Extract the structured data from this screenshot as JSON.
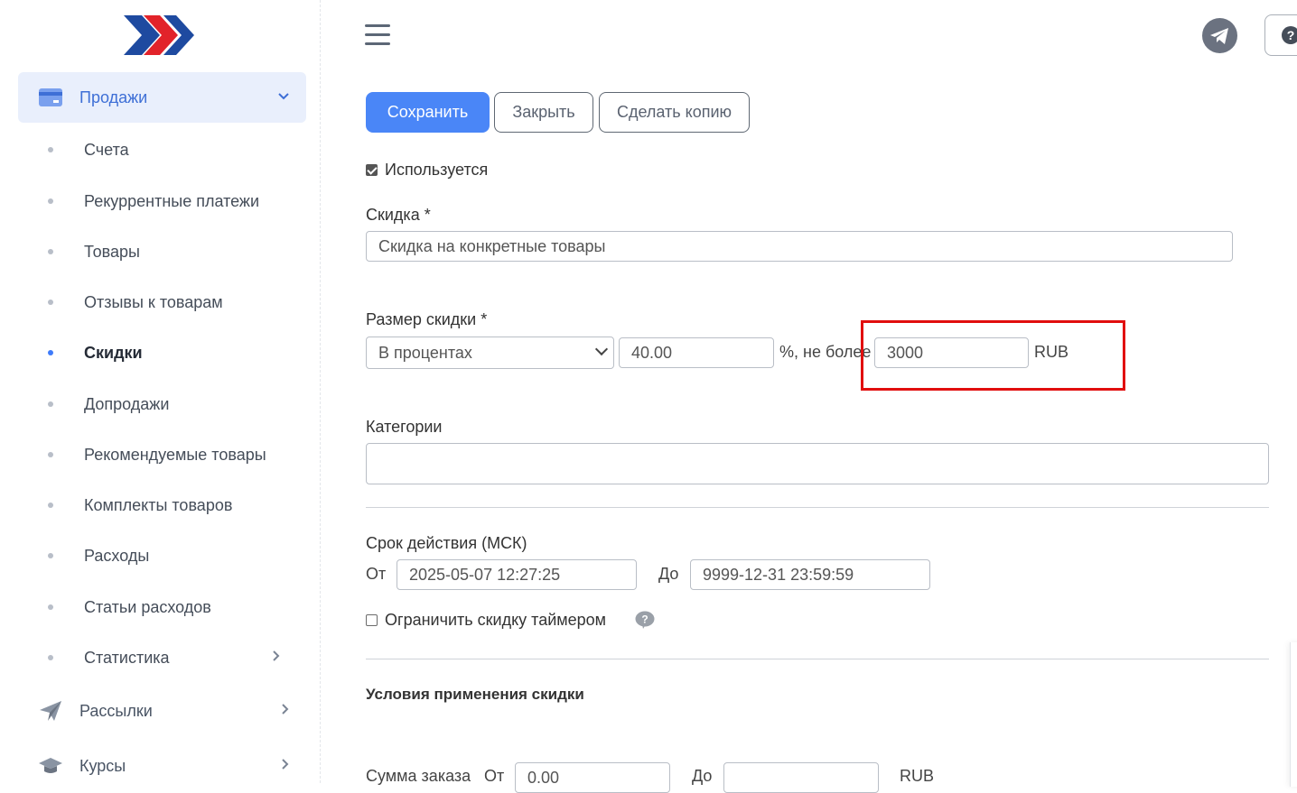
{
  "sidebar": {
    "section_sales": "Продажи",
    "items": [
      {
        "label": "Счета"
      },
      {
        "label": "Рекуррентные платежи"
      },
      {
        "label": "Товары"
      },
      {
        "label": "Отзывы к товарам"
      },
      {
        "label": "Скидки"
      },
      {
        "label": "Допродажи"
      },
      {
        "label": "Рекомендуемые товары"
      },
      {
        "label": "Комплекты товаров"
      },
      {
        "label": "Расходы"
      },
      {
        "label": "Статьи расходов"
      },
      {
        "label": "Статистика"
      }
    ],
    "section_mailings": "Рассылки",
    "section_courses": "Курсы"
  },
  "toolbar": {
    "save_label": "Сохранить",
    "close_label": "Закрыть",
    "copy_label": "Сделать копию"
  },
  "form": {
    "active_label": "Используется",
    "active_checked": true,
    "discount_label": "Скидка *",
    "discount_value": "Скидка на конкретные товары",
    "size_label": "Размер скидки *",
    "size_type_selected": "В процентах",
    "size_value": "40.00",
    "percent_max_text": "%, не более",
    "max_value": "3000",
    "currency": "RUB",
    "categories_label": "Категории",
    "categories_value": "",
    "period_label": "Срок действия (МСК)",
    "from_label": "От",
    "from_value": "2025-05-07 12:27:25",
    "to_label": "До",
    "to_value": "9999-12-31 23:59:59",
    "timer_label": "Ограничить скидку таймером",
    "timer_checked": false,
    "conditions_title": "Условия применения скидки",
    "order_sum_label": "Сумма заказа",
    "order_from_label": "От",
    "order_from_value": "0.00",
    "order_to_label": "До",
    "order_to_value": "",
    "order_currency": "RUB"
  },
  "colors": {
    "primary": "#4a86f7",
    "sidebar_active_bg": "#e9effc",
    "highlight_box": "#e10e0e",
    "logo_blue": "#1e4aa0",
    "logo_red": "#e2232a"
  },
  "icons": [
    "logo-chevrons-icon",
    "card-icon",
    "chevron-down-icon",
    "chevron-right-icon",
    "paper-plane-icon",
    "graduation-cap-icon",
    "hamburger-icon",
    "telegram-icon",
    "question-icon",
    "help-bubble-icon"
  ]
}
